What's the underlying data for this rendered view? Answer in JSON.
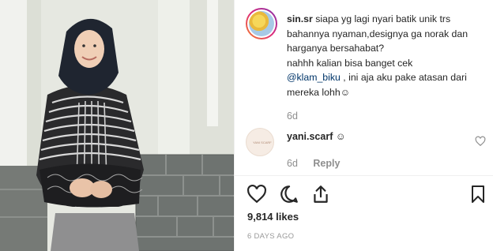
{
  "post": {
    "image_alt": "woman in hijab wearing black and white batik top",
    "author_username": "sin.sr",
    "caption_part1": "siapa yg lagi nyari batik unik trs bahannya nyaman,designya ga norak dan harganya bersahabat?",
    "caption_part2": "nahhh kalian bisa banget cek",
    "caption_mention": "@klam_biku",
    "caption_part3": ", ini aja aku pake atasan dari mereka lohh☺",
    "caption_age": "6d"
  },
  "comment": {
    "username": "yani.scarf",
    "emoji": "☺",
    "age": "6d",
    "reply_label": "Reply",
    "avatar_text": "YANI SCARF"
  },
  "actions": {
    "likes": "9,814 likes",
    "posted": "6 DAYS AGO"
  },
  "colors": {
    "accent_link": "#003569",
    "muted_text": "#8e8e8e"
  },
  "icons": {
    "like": "heart-icon",
    "comment": "comment-icon",
    "share": "share-icon",
    "save": "bookmark-icon",
    "comment_like": "small-heart-icon"
  }
}
